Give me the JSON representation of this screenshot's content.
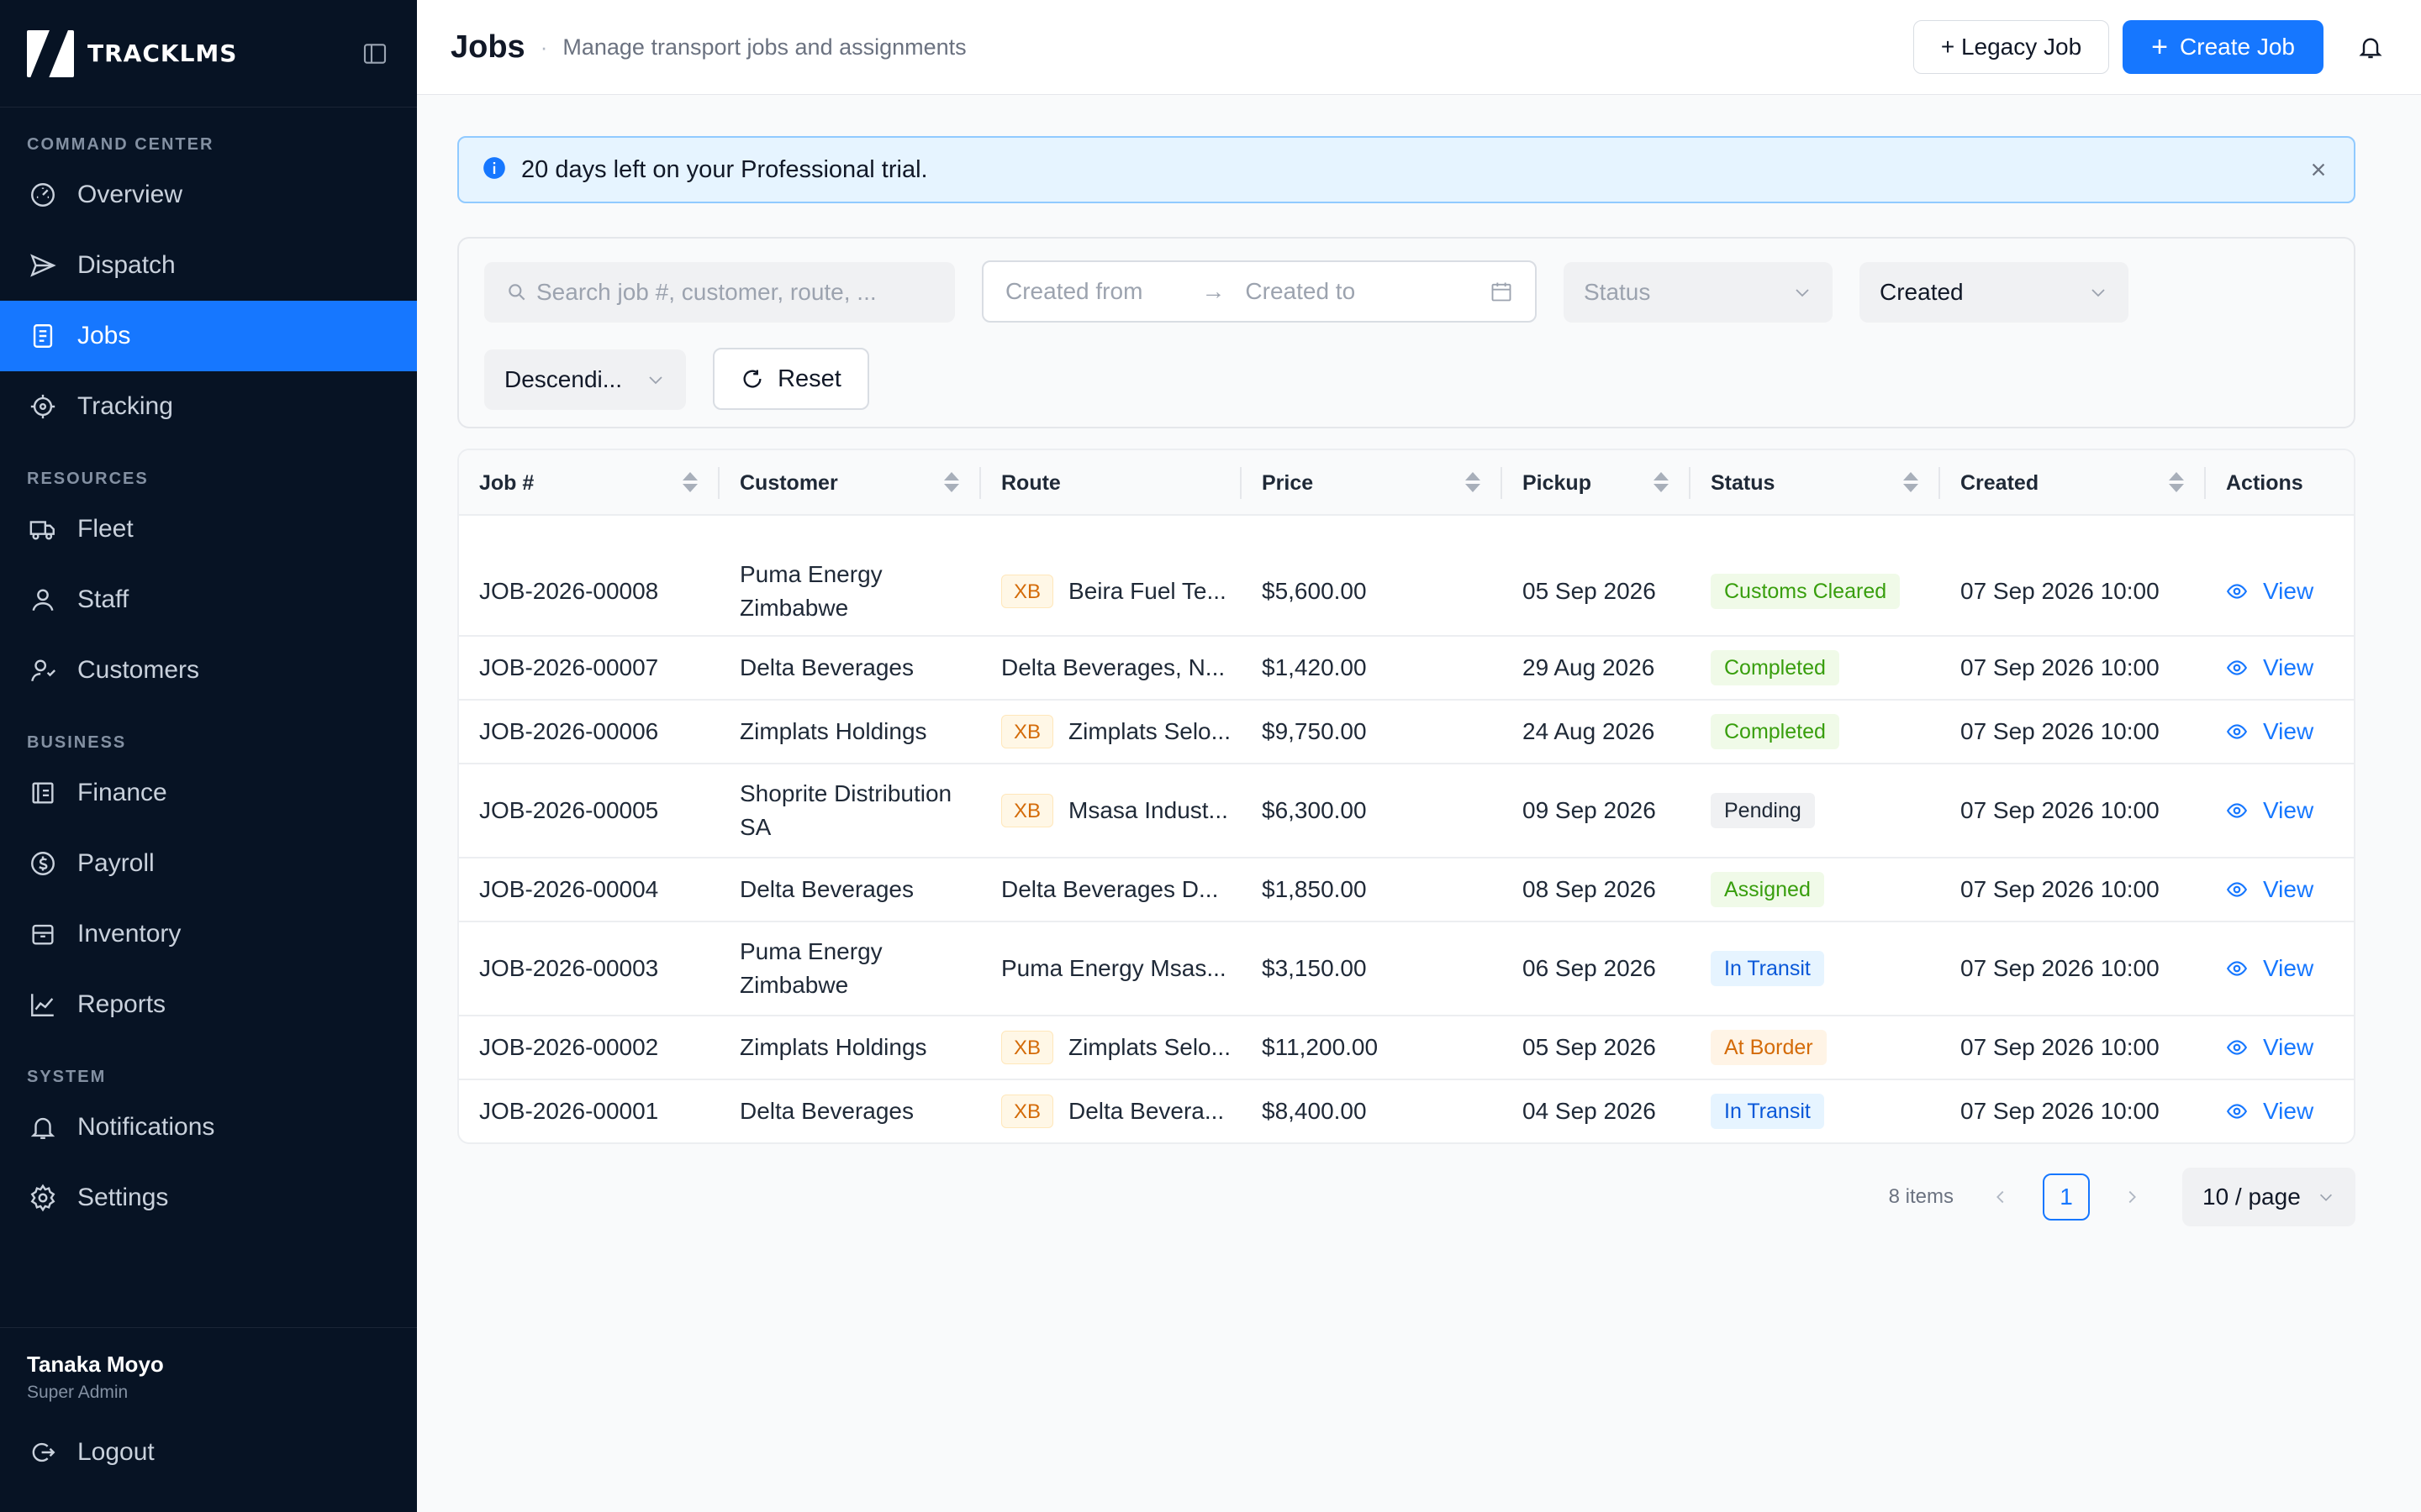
{
  "app": {
    "logo_text": "TRACKLMS"
  },
  "sidebar": {
    "sections": [
      {
        "label": "COMMAND CENTER"
      },
      {
        "label": "RESOURCES"
      },
      {
        "label": "BUSINESS"
      },
      {
        "label": "SYSTEM"
      }
    ],
    "items": [
      {
        "label": "Overview",
        "icon": "dashboard-gauge-icon"
      },
      {
        "label": "Dispatch",
        "icon": "send-icon"
      },
      {
        "label": "Jobs",
        "icon": "document-icon",
        "active": true
      },
      {
        "label": "Tracking",
        "icon": "crosshair-icon"
      },
      {
        "label": "Fleet",
        "icon": "truck-icon"
      },
      {
        "label": "Staff",
        "icon": "user-icon"
      },
      {
        "label": "Customers",
        "icon": "users-icon"
      },
      {
        "label": "Finance",
        "icon": "ledger-icon"
      },
      {
        "label": "Payroll",
        "icon": "dollar-circle-icon"
      },
      {
        "label": "Inventory",
        "icon": "box-icon"
      },
      {
        "label": "Reports",
        "icon": "chart-line-icon"
      },
      {
        "label": "Notifications",
        "icon": "bell-icon"
      },
      {
        "label": "Settings",
        "icon": "gear-icon"
      }
    ],
    "user": {
      "name": "Tanaka Moyo",
      "role": "Super Admin"
    },
    "logout_label": "Logout"
  },
  "header": {
    "title": "Jobs",
    "subtitle": "Manage transport jobs and assignments",
    "legacy_button": "+ Legacy Job",
    "create_button": "Create Job"
  },
  "banner": {
    "text": "20 days left on your Professional trial."
  },
  "filters": {
    "search_placeholder": "Search job #, customer, route, ...",
    "created_from_placeholder": "Created from",
    "created_to_placeholder": "Created to",
    "status_placeholder": "Status",
    "sort_field": "Created",
    "sort_order": "Descendi...",
    "reset_label": "Reset"
  },
  "table": {
    "columns": [
      "Job #",
      "Customer",
      "Route",
      "Price",
      "Pickup",
      "Status",
      "Created",
      "Actions"
    ],
    "rows": [
      {
        "job": "JOB-2026-00008",
        "customer": "Puma Energy Zimbabwe",
        "xb": "XB",
        "route": "Beira Fuel Te...",
        "price": "$5,600.00",
        "pickup": "05 Sep 2026",
        "status": "Customs Cleared",
        "status_color": "green",
        "created": "07 Sep 2026 10:00",
        "action": "View"
      },
      {
        "job": "JOB-2026-00007",
        "customer": "Delta Beverages",
        "xb": "",
        "route": "Delta Beverages, N...",
        "price": "$1,420.00",
        "pickup": "29 Aug 2026",
        "status": "Completed",
        "status_color": "green",
        "created": "07 Sep 2026 10:00",
        "action": "View"
      },
      {
        "job": "JOB-2026-00006",
        "customer": "Zimplats Holdings",
        "xb": "XB",
        "route": "Zimplats Selo...",
        "price": "$9,750.00",
        "pickup": "24 Aug 2026",
        "status": "Completed",
        "status_color": "green",
        "created": "07 Sep 2026 10:00",
        "action": "View"
      },
      {
        "job": "JOB-2026-00005",
        "customer": "Shoprite Distribution SA",
        "xb": "XB",
        "route": "Msasa Indust...",
        "price": "$6,300.00",
        "pickup": "09 Sep 2026",
        "status": "Pending",
        "status_color": "gray",
        "created": "07 Sep 2026 10:00",
        "action": "View"
      },
      {
        "job": "JOB-2026-00004",
        "customer": "Delta Beverages",
        "xb": "",
        "route": "Delta Beverages D...",
        "price": "$1,850.00",
        "pickup": "08 Sep 2026",
        "status": "Assigned",
        "status_color": "green",
        "created": "07 Sep 2026 10:00",
        "action": "View"
      },
      {
        "job": "JOB-2026-00003",
        "customer": "Puma Energy Zimbabwe",
        "xb": "",
        "route": "Puma Energy Msas...",
        "price": "$3,150.00",
        "pickup": "06 Sep 2026",
        "status": "In Transit",
        "status_color": "blue",
        "created": "07 Sep 2026 10:00",
        "action": "View"
      },
      {
        "job": "JOB-2026-00002",
        "customer": "Zimplats Holdings",
        "xb": "XB",
        "route": "Zimplats Selo...",
        "price": "$11,200.00",
        "pickup": "05 Sep 2026",
        "status": "At Border",
        "status_color": "orange",
        "created": "07 Sep 2026 10:00",
        "action": "View"
      },
      {
        "job": "JOB-2026-00001",
        "customer": "Delta Beverages",
        "xb": "XB",
        "route": "Delta Bevera...",
        "price": "$8,400.00",
        "pickup": "04 Sep 2026",
        "status": "In Transit",
        "status_color": "blue",
        "created": "07 Sep 2026 10:00",
        "action": "View"
      }
    ]
  },
  "pagination": {
    "items_label": "8 items",
    "current_page": "1",
    "page_size": "10 / page"
  },
  "colors": {
    "sidebar_bg": "#071324",
    "accent": "#1677ff",
    "banner_bg": "#e6f4ff"
  }
}
